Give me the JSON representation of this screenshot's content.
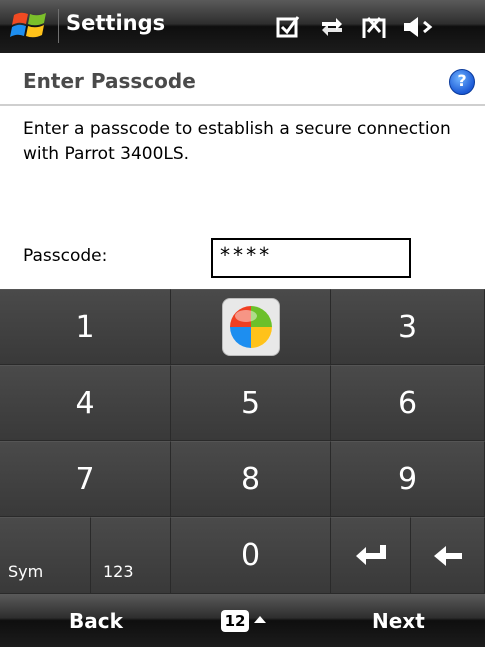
{
  "titlebar": {
    "app_title": "Settings"
  },
  "header": {
    "title": "Enter Passcode",
    "help_glyph": "?"
  },
  "description": "Enter a passcode to establish a secure connection with Parrot 3400LS.",
  "passcode": {
    "label": "Passcode:",
    "value": "****"
  },
  "keypad": {
    "k1": "1",
    "k3": "3",
    "k4": "4",
    "k5": "5",
    "k6": "6",
    "k7": "7",
    "k8": "8",
    "k9": "9",
    "sym": "Sym",
    "k123": "123",
    "k0": "0"
  },
  "bottombar": {
    "left": "Back",
    "keyboard": "12",
    "right": "Next"
  }
}
